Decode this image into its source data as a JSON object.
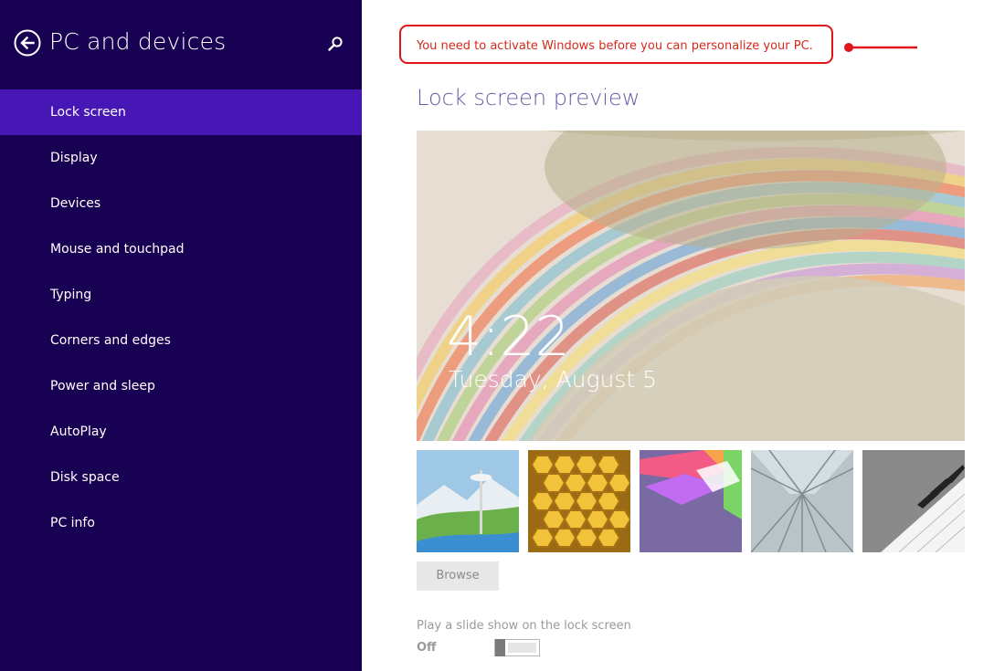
{
  "sidebar": {
    "title": "PC and devices",
    "back_icon": "back-arrow-circle-icon",
    "search_icon": "search-icon",
    "items": [
      {
        "label": "Lock screen",
        "selected": true
      },
      {
        "label": "Display"
      },
      {
        "label": "Devices"
      },
      {
        "label": "Mouse and touchpad"
      },
      {
        "label": "Typing"
      },
      {
        "label": "Corners and edges"
      },
      {
        "label": "Power and sleep"
      },
      {
        "label": "AutoPlay"
      },
      {
        "label": "Disk space"
      },
      {
        "label": "PC info"
      }
    ]
  },
  "main": {
    "activation_warning": "You need to activate Windows before you can personalize your PC.",
    "preview_heading": "Lock screen preview",
    "preview": {
      "time": "4:22",
      "date": "Tuesday, August 5"
    },
    "thumbnails": [
      "space-needle-thumbnail",
      "honeycomb-thumbnail",
      "geometric-shapes-thumbnail",
      "escalator-thumbnail",
      "piano-keys-thumbnail"
    ],
    "browse_label": "Browse",
    "slideshow_label": "Play a slide show on the lock screen",
    "slideshow_state": "Off"
  },
  "colors": {
    "sidebar_bg": "#180052",
    "selected_item": "#4617b4",
    "heading": "#6a5ba6",
    "warning": "#d42a1c",
    "annotation": "#e0141a"
  }
}
